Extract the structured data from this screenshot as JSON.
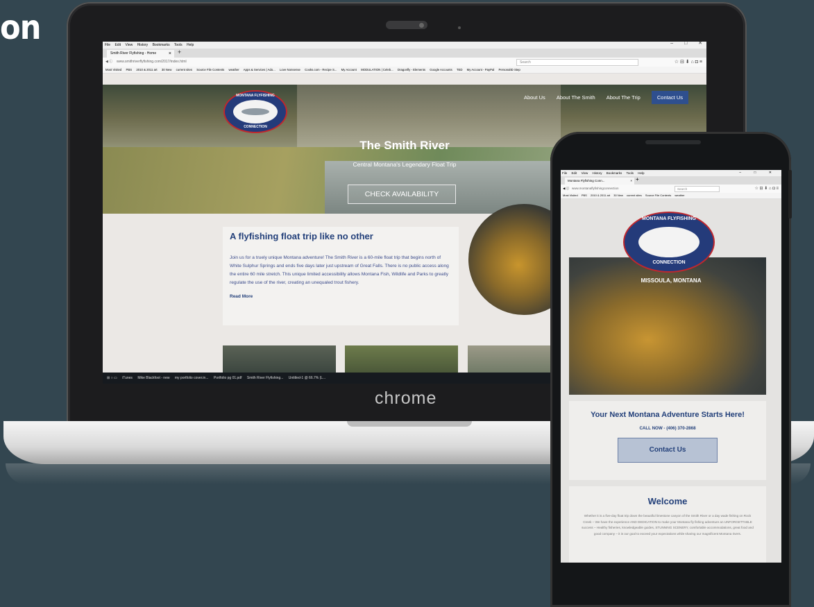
{
  "heading_fragment": "on",
  "laptop": {
    "brand": "chrome",
    "browser": {
      "menu": [
        "File",
        "Edit",
        "View",
        "History",
        "Bookmarks",
        "Tools",
        "Help"
      ],
      "tab_title": "Smith River Flyfishing - Home",
      "url": "www.smithriverflyfishing.com/2017/index.html",
      "search_placeholder": "Search",
      "bookmarks": [
        "Most Visited",
        "PBS",
        "2010 & 2011 art",
        "30 New",
        "current sites",
        "Source File Contents",
        "weather",
        "Apps & Services | Ado...",
        "Love Nonsense",
        "Cooks.com - Recipe S...",
        "My Account",
        "MODULATION | Celeb...",
        "Dragonfly - Elements",
        "Google Accounts",
        "TED",
        "My Account - PayPal",
        "PersonalID Step"
      ]
    },
    "site": {
      "logo_top": "MONTANA FLYFISHING",
      "logo_bottom": "CONNECTION",
      "nav": [
        "About Us",
        "About The Smith",
        "About The Trip",
        "Contact Us"
      ],
      "hero_title": "The Smith River",
      "hero_subtitle": "Central Montana's Legendary Float Trip",
      "hero_button": "CHECK AVAILABILITY",
      "card_title": "A flyfishing float trip like no other",
      "card_body": "Join us for a truely unique Montana adventure! The Smith River is a 60-mile float trip that begins north of White Sulphur Springs and ends five days later just upstream of Great Falls. There is no public access along the entire 60 mile stretch. This unique limited accessibility allows Montana Fish, Wildlife and Parks to greatly regulate the use of the river, creating an unequaled trout fishery.",
      "read_more": "Read More"
    },
    "taskbar": [
      "iTunes",
      "Mike Blackfoot - new",
      "my portfolio cover.in...",
      "Portfolio pg 01.pdf",
      "Smith River Flyfishing...",
      "Untitled-1 @ 66.7% (L..."
    ]
  },
  "phone": {
    "browser": {
      "menu": [
        "File",
        "Edit",
        "View",
        "History",
        "Bookmarks",
        "Tools",
        "Help"
      ],
      "tab_title": "Montana Flyfishing Conn...",
      "url": "www.montanaflyfishingconnection",
      "search_placeholder": "Search",
      "bookmarks": [
        "Most Visited",
        "PBS",
        "2010 & 2011 art",
        "30 New",
        "current sites",
        "Source File Contents",
        "weather"
      ]
    },
    "site": {
      "logo_top": "MONTANA FLYFISHING",
      "logo_bottom": "CONNECTION",
      "location": "MISSOULA, MONTANA",
      "promo_title": "Your Next Montana Adventure Starts Here!",
      "call": "CALL NOW - (406) 370-2868",
      "contact_button": "Contact Us",
      "welcome_title": "Welcome",
      "welcome_body": "Whether it is a five-day float trip down the beautiful limestone canyon of the Smith River or a day wade fishing on Rock Creek – We have the experience AND DEDICATION to make your Montana fly fishing adventure an UNFORGETTABLE success – Healthy fisheries, knowledgeable guides, STUNNING SCENERY, comfortable accommodations, great food and good company – it is our goal to exceed your expectations while sharing our magnificent Montana rivers."
    }
  }
}
